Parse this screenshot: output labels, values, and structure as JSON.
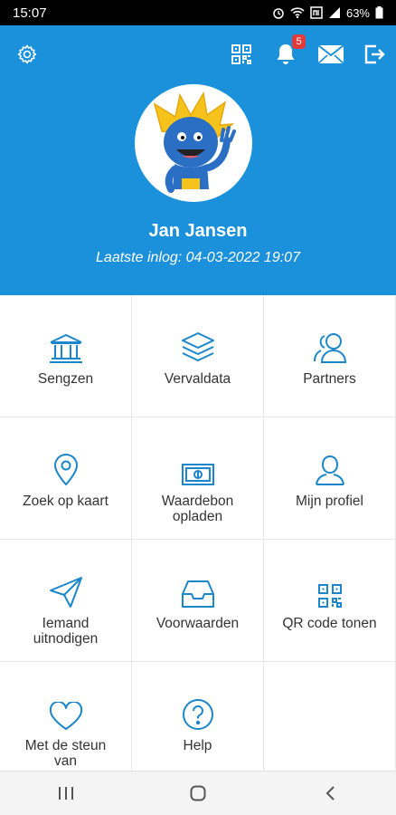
{
  "status_bar": {
    "time": "15:07",
    "battery": "63%"
  },
  "header": {
    "notification_count": "5",
    "user_name": "Jan Jansen",
    "last_login": "Laatste inlog: 04-03-2022 19:07"
  },
  "tiles": [
    {
      "label": "Sengzen",
      "icon": "bank-icon"
    },
    {
      "label": "Vervaldata",
      "icon": "layers-icon"
    },
    {
      "label": "Partners",
      "icon": "users-icon"
    },
    {
      "label": "Zoek op kaart",
      "icon": "map-pin-icon"
    },
    {
      "label": "Waardebon\nopladen",
      "icon": "money-icon"
    },
    {
      "label": "Mijn profiel",
      "icon": "user-icon"
    },
    {
      "label": "Iemand\nuitnodigen",
      "icon": "send-icon"
    },
    {
      "label": "Voorwaarden",
      "icon": "inbox-icon"
    },
    {
      "label": "QR code tonen",
      "icon": "qr-code-icon"
    },
    {
      "label": "Met de steun\nvan",
      "icon": "heart-icon"
    },
    {
      "label": "Help",
      "icon": "help-icon"
    }
  ],
  "colors": {
    "brand": "#1b91db",
    "icon": "#1b86c9"
  }
}
